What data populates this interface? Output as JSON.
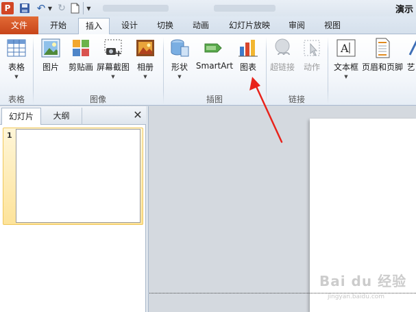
{
  "titlebar": {
    "app_icon_letter": "P",
    "title": "演示"
  },
  "tabs": {
    "file": "文件",
    "home": "开始",
    "insert": "插入",
    "design": "设计",
    "transitions": "切换",
    "animations": "动画",
    "slideshow": "幻灯片放映",
    "review": "审阅",
    "view": "视图"
  },
  "ribbon": {
    "table": {
      "label": "表格",
      "group": "表格"
    },
    "images": {
      "picture": "图片",
      "clipart": "剪贴画",
      "screenshot": "屏幕截图",
      "album": "相册",
      "group": "图像"
    },
    "illustrations": {
      "shapes": "形状",
      "smartart": "SmartArt",
      "chart": "图表",
      "group": "插图"
    },
    "links": {
      "hyperlink": "超链接",
      "action": "动作",
      "group": "链接"
    },
    "text": {
      "textbox": "文本框",
      "header_footer": "页眉和页脚",
      "wordart": "艺"
    }
  },
  "left_pane": {
    "tab_slides": "幻灯片",
    "tab_outline": "大纲",
    "close": "✕",
    "slide_number": "1"
  },
  "watermark": {
    "text": "Bai du 经验",
    "sub": "jingyan.baidu.com"
  },
  "colors": {
    "file_tab": "#d0521f",
    "arrow": "#e8231b",
    "selection_highlight": "#fde39a"
  }
}
